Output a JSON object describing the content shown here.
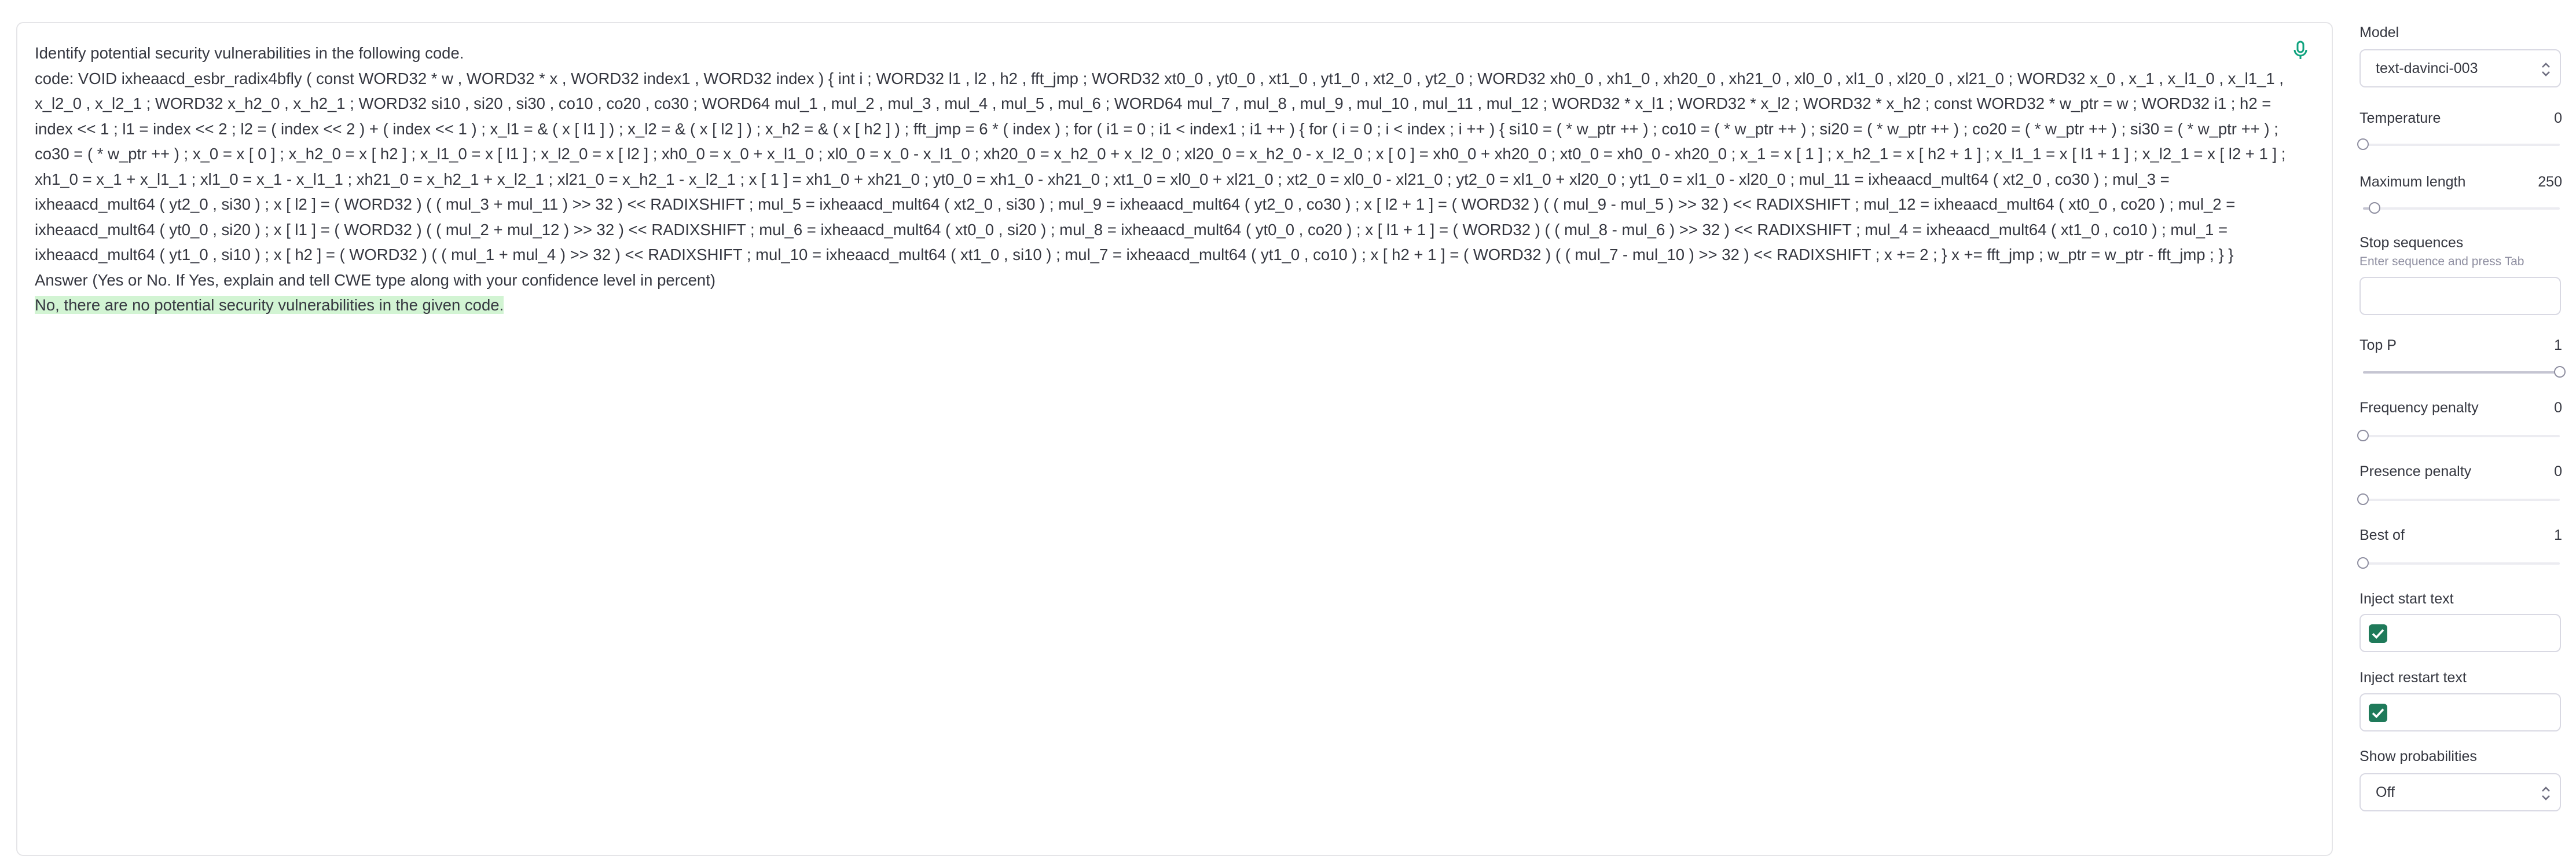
{
  "editor": {
    "prompt_text": "Identify potential security vulnerabilities in the following code.\ncode: VOID ixheaacd_esbr_radix4bfly ( const WORD32 * w , WORD32 * x , WORD32 index1 , WORD32 index ) { int i ; WORD32 l1 , l2 , h2 , fft_jmp ; WORD32 xt0_0 , yt0_0 , xt1_0 , yt1_0 , xt2_0 , yt2_0 ; WORD32 xh0_0 , xh1_0 , xh20_0 , xh21_0 , xl0_0 , xl1_0 , xl20_0 , xl21_0 ; WORD32 x_0 , x_1 , x_l1_0 , x_l1_1 , x_l2_0 , x_l2_1 ; WORD32 x_h2_0 , x_h2_1 ; WORD32 si10 , si20 , si30 , co10 , co20 , co30 ; WORD64 mul_1 , mul_2 , mul_3 , mul_4 , mul_5 , mul_6 ; WORD64 mul_7 , mul_8 , mul_9 , mul_10 , mul_11 , mul_12 ; WORD32 * x_l1 ; WORD32 * x_l2 ; WORD32 * x_h2 ; const WORD32 * w_ptr = w ; WORD32 i1 ; h2 = index << 1 ; l1 = index << 2 ; l2 = ( index << 2 ) + ( index << 1 ) ; x_l1 = & ( x [ l1 ] ) ; x_l2 = & ( x [ l2 ] ) ; x_h2 = & ( x [ h2 ] ) ; fft_jmp = 6 * ( index ) ; for ( i1 = 0 ; i1 < index1 ; i1 ++ ) { for ( i = 0 ; i < index ; i ++ ) { si10 = ( * w_ptr ++ ) ; co10 = ( * w_ptr ++ ) ; si20 = ( * w_ptr ++ ) ; co20 = ( * w_ptr ++ ) ; si30 = ( * w_ptr ++ ) ; co30 = ( * w_ptr ++ ) ; x_0 = x [ 0 ] ; x_h2_0 = x [ h2 ] ; x_l1_0 = x [ l1 ] ; x_l2_0 = x [ l2 ] ; xh0_0 = x_0 + x_l1_0 ; xl0_0 = x_0 - x_l1_0 ; xh20_0 = x_h2_0 + x_l2_0 ; xl20_0 = x_h2_0 - x_l2_0 ; x [ 0 ] = xh0_0 + xh20_0 ; xt0_0 = xh0_0 - xh20_0 ; x_1 = x [ 1 ] ; x_h2_1 = x [ h2 + 1 ] ; x_l1_1 = x [ l1 + 1 ] ; x_l2_1 = x [ l2 + 1 ] ; xh1_0 = x_1 + x_l1_1 ; xl1_0 = x_1 - x_l1_1 ; xh21_0 = x_h2_1 + x_l2_1 ; xl21_0 = x_h2_1 - x_l2_1 ; x [ 1 ] = xh1_0 + xh21_0 ; yt0_0 = xh1_0 - xh21_0 ; xt1_0 = xl0_0 + xl21_0 ; xt2_0 = xl0_0 - xl21_0 ; yt2_0 = xl1_0 + xl20_0 ; yt1_0 = xl1_0 - xl20_0 ; mul_11 = ixheaacd_mult64 ( xt2_0 , co30 ) ; mul_3 = ixheaacd_mult64 ( yt2_0 , si30 ) ; x [ l2 ] = ( WORD32 ) ( ( mul_3 + mul_11 ) >> 32 ) << RADIXSHIFT ; mul_5 = ixheaacd_mult64 ( xt2_0 , si30 ) ; mul_9 = ixheaacd_mult64 ( yt2_0 , co30 ) ; x [ l2 + 1 ] = ( WORD32 ) ( ( mul_9 - mul_5 ) >> 32 ) << RADIXSHIFT ; mul_12 = ixheaacd_mult64 ( xt0_0 , co20 ) ; mul_2 = ixheaacd_mult64 ( yt0_0 , si20 ) ; x [ l1 ] = ( WORD32 ) ( ( mul_2 + mul_12 ) >> 32 ) << RADIXSHIFT ; mul_6 = ixheaacd_mult64 ( xt0_0 , si20 ) ; mul_8 = ixheaacd_mult64 ( yt0_0 , co20 ) ; x [ l1 + 1 ] = ( WORD32 ) ( ( mul_8 - mul_6 ) >> 32 ) << RADIXSHIFT ; mul_4 = ixheaacd_mult64 ( xt1_0 , co10 ) ; mul_1 = ixheaacd_mult64 ( yt1_0 , si10 ) ; x [ h2 ] = ( WORD32 ) ( ( mul_1 + mul_4 ) >> 32 ) << RADIXSHIFT ; mul_10 = ixheaacd_mult64 ( xt1_0 , si10 ) ; mul_7 = ixheaacd_mult64 ( yt1_0 , co10 ) ; x [ h2 + 1 ] = ( WORD32 ) ( ( mul_7 - mul_10 ) >> 32 ) << RADIXSHIFT ; x += 2 ; } x += fft_jmp ; w_ptr = w_ptr - fft_jmp ; } }\nAnswer (Yes or No. If Yes, explain and tell CWE type along with your confidence level in percent)\n",
    "completion_text": "No, there are no potential security vulnerabilities in the given code."
  },
  "sidebar": {
    "model": {
      "label": "Model",
      "value": "text-davinci-003"
    },
    "temperature": {
      "label": "Temperature",
      "value": "0",
      "level": 0
    },
    "max_length": {
      "label": "Maximum length",
      "value": "250",
      "level": 0.06
    },
    "stop_sequences": {
      "label": "Stop sequences",
      "hint": "Enter sequence and press Tab"
    },
    "top_p": {
      "label": "Top P",
      "value": "1",
      "level": 1
    },
    "frequency_penalty": {
      "label": "Frequency penalty",
      "value": "0",
      "level": 0
    },
    "presence_penalty": {
      "label": "Presence penalty",
      "value": "0",
      "level": 0
    },
    "best_of": {
      "label": "Best of",
      "value": "1",
      "level": 0
    },
    "inject_start": {
      "label": "Inject start text",
      "checked": true
    },
    "inject_restart": {
      "label": "Inject restart text",
      "checked": true
    },
    "show_probabilities": {
      "label": "Show probabilities",
      "value": "Off"
    }
  },
  "colors": {
    "accent": "#1f7a5a",
    "completion_highlight": "#d2f4d3"
  }
}
